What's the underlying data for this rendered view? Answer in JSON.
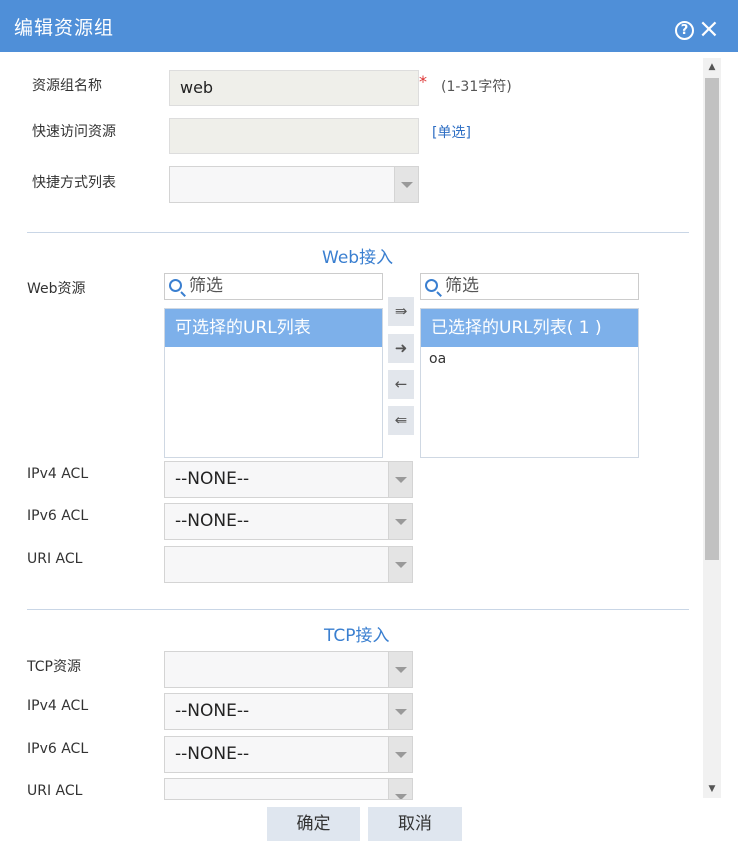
{
  "dialog": {
    "title": "编辑资源组",
    "help_icon": "?",
    "close_icon": "×"
  },
  "basic": {
    "name_label": "资源组名称",
    "name_value": "web",
    "required_mark": "*",
    "name_hint": "(1-31字符)",
    "quick_label": "快速访问资源",
    "quick_value": "",
    "single_select_link": "[单选]",
    "shortcut_label": "快捷方式列表",
    "shortcut_value": ""
  },
  "web": {
    "section_title": "Web接入",
    "resource_label": "Web资源",
    "filter_placeholder_left": "筛选",
    "filter_placeholder_right": "筛选",
    "available_header": "可选择的URL列表",
    "available_items": [],
    "selected_header": "已选择的URL列表( 1 )",
    "selected_items": [
      "oa"
    ],
    "ipv4_label": "IPv4 ACL",
    "ipv4_value": "--NONE--",
    "ipv6_label": "IPv6 ACL",
    "ipv6_value": "--NONE--",
    "uri_label": "URI ACL",
    "uri_value": ""
  },
  "tcp": {
    "section_title": "TCP接入",
    "resource_label": "TCP资源",
    "resource_value": "",
    "ipv4_label": "IPv4 ACL",
    "ipv4_value": "--NONE--",
    "ipv6_label": "IPv6 ACL",
    "ipv6_value": "--NONE--",
    "uri_label": "URI ACL",
    "uri_value": ""
  },
  "move_buttons": {
    "add_all": "⇛",
    "add": "➜",
    "remove": "←",
    "remove_all": "⇚"
  },
  "footer": {
    "ok_label": "确定",
    "cancel_label": "取消"
  },
  "colors": {
    "titlebar": "#4f8fd8",
    "accent": "#3a7fd0",
    "list_header": "#7db0ea",
    "required": "#dd3333"
  }
}
